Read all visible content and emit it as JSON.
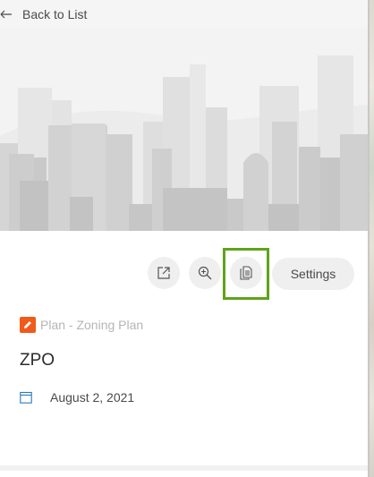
{
  "nav": {
    "back_label": "Back to List"
  },
  "hero": {
    "icon": "city-skyline-placeholder"
  },
  "actions": {
    "open_icon": "external-link-icon",
    "zoom_icon": "zoom-in-icon",
    "copy_icon": "copy-document-icon",
    "settings_label": "Settings",
    "highlight_color": "#5fa319"
  },
  "item": {
    "type_label": "Plan - Zoning Plan",
    "type_icon": "pencil-icon",
    "type_color": "#f05a1a",
    "title": "ZPO",
    "date_icon": "calendar-icon",
    "date": "August 2, 2021"
  }
}
